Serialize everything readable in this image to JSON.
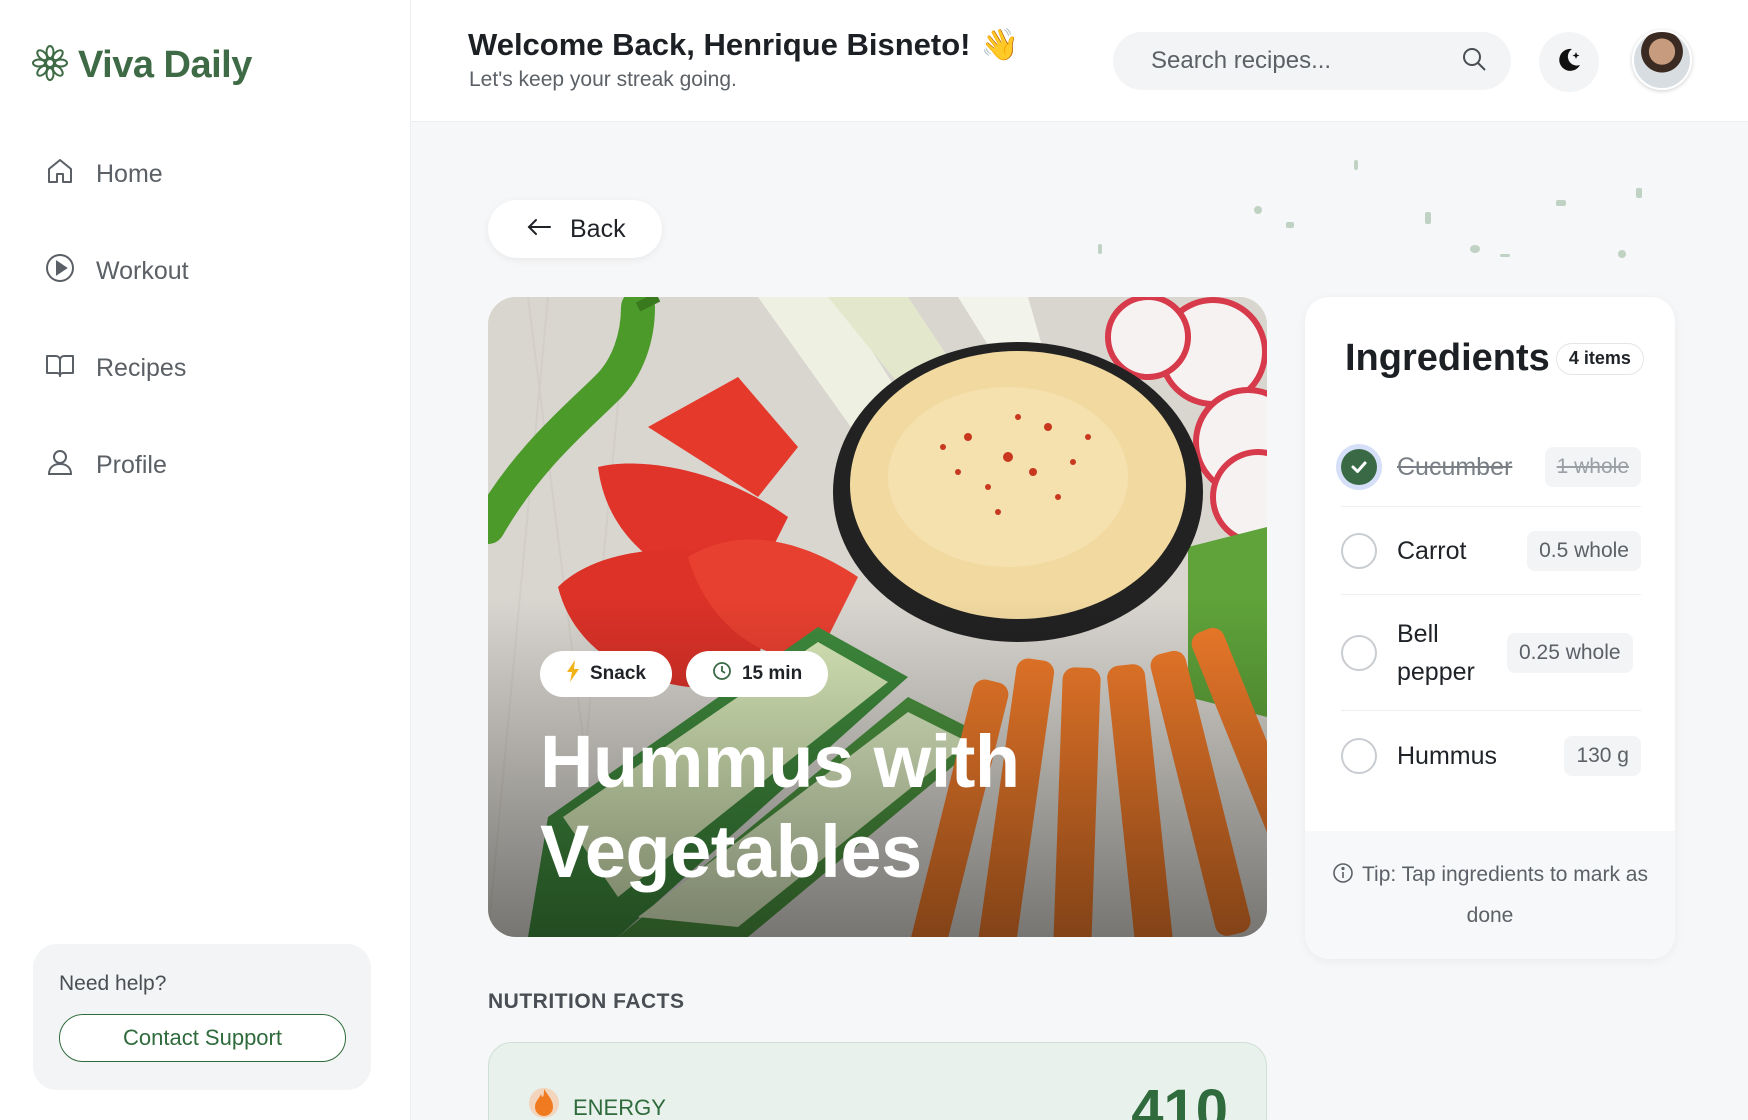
{
  "app": {
    "name": "Viva Daily",
    "brand_color": "#3e6b45"
  },
  "sidebar": {
    "items": [
      {
        "label": "Home",
        "icon": "home-icon"
      },
      {
        "label": "Workout",
        "icon": "play-circle-icon"
      },
      {
        "label": "Recipes",
        "icon": "book-icon"
      },
      {
        "label": "Profile",
        "icon": "user-icon"
      }
    ],
    "help": {
      "text": "Need help?",
      "button": "Contact Support"
    }
  },
  "header": {
    "welcome": "Welcome Back, Henrique Bisneto!",
    "welcome_emoji": "👋",
    "subtitle": "Let's keep your streak going.",
    "search_placeholder": "Search recipes..."
  },
  "main": {
    "back_label": "Back",
    "recipe": {
      "category": "Snack",
      "duration": "15 min",
      "title": "Hummus with Vegetables"
    },
    "ingredients": {
      "title": "Ingredients",
      "count_label": "4 items",
      "items": [
        {
          "name": "Cucumber",
          "qty": "1 whole",
          "done": true
        },
        {
          "name": "Carrot",
          "qty": "0.5 whole",
          "done": false
        },
        {
          "name": "Bell pepper",
          "qty": "0.25 whole",
          "done": false
        },
        {
          "name": "Hummus",
          "qty": "130 g",
          "done": false
        }
      ],
      "tip": "Tip: Tap ingredients to mark as done"
    },
    "nutrition": {
      "title": "NUTRITION FACTS",
      "energy_label": "ENERGY",
      "energy_value": "410"
    }
  }
}
